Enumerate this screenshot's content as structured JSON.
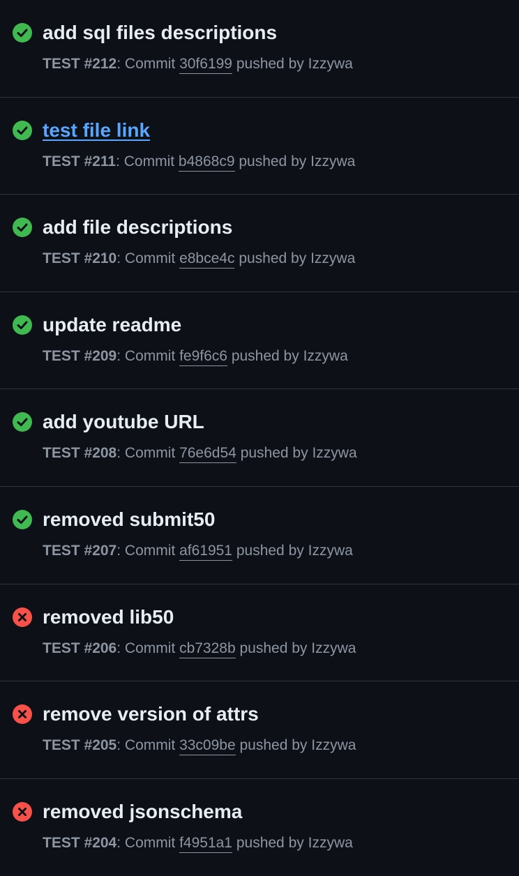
{
  "colors": {
    "success": "#3fb950",
    "failure": "#f85149",
    "background": "#0d1117",
    "border": "#30363d",
    "title": "#e6edf3",
    "link": "#58a6ff",
    "muted": "#8d96a0"
  },
  "runs": [
    {
      "title": "add sql files descriptions",
      "status": "success",
      "status_icon": "check-circle-icon",
      "workflow": "TEST",
      "run_number": "#212",
      "commit_label": ": Commit",
      "sha": "30f6199",
      "pushed_label": "pushed by",
      "author": "Izzywa"
    },
    {
      "title": "test file link",
      "status": "success",
      "status_icon": "check-circle-icon",
      "workflow": "TEST",
      "run_number": "#211",
      "commit_label": ": Commit",
      "sha": "b4868c9",
      "pushed_label": "pushed by",
      "author": "Izzywa"
    },
    {
      "title": "add file descriptions",
      "status": "success",
      "status_icon": "check-circle-icon",
      "workflow": "TEST",
      "run_number": "#210",
      "commit_label": ": Commit",
      "sha": "e8bce4c",
      "pushed_label": "pushed by",
      "author": "Izzywa"
    },
    {
      "title": "update readme",
      "status": "success",
      "status_icon": "check-circle-icon",
      "workflow": "TEST",
      "run_number": "#209",
      "commit_label": ": Commit",
      "sha": "fe9f6c6",
      "pushed_label": "pushed by",
      "author": "Izzywa"
    },
    {
      "title": "add youtube URL",
      "status": "success",
      "status_icon": "check-circle-icon",
      "workflow": "TEST",
      "run_number": "#208",
      "commit_label": ": Commit",
      "sha": "76e6d54",
      "pushed_label": "pushed by",
      "author": "Izzywa"
    },
    {
      "title": "removed submit50",
      "status": "success",
      "status_icon": "check-circle-icon",
      "workflow": "TEST",
      "run_number": "#207",
      "commit_label": ": Commit",
      "sha": "af61951",
      "pushed_label": "pushed by",
      "author": "Izzywa"
    },
    {
      "title": "removed lib50",
      "status": "failure",
      "status_icon": "x-circle-icon",
      "workflow": "TEST",
      "run_number": "#206",
      "commit_label": ": Commit",
      "sha": "cb7328b",
      "pushed_label": "pushed by",
      "author": "Izzywa"
    },
    {
      "title": "remove version of attrs",
      "status": "failure",
      "status_icon": "x-circle-icon",
      "workflow": "TEST",
      "run_number": "#205",
      "commit_label": ": Commit",
      "sha": "33c09be",
      "pushed_label": "pushed by",
      "author": "Izzywa"
    },
    {
      "title": "removed jsonschema",
      "status": "failure",
      "status_icon": "x-circle-icon",
      "workflow": "TEST",
      "run_number": "#204",
      "commit_label": ": Commit",
      "sha": "f4951a1",
      "pushed_label": "pushed by",
      "author": "Izzywa"
    }
  ]
}
